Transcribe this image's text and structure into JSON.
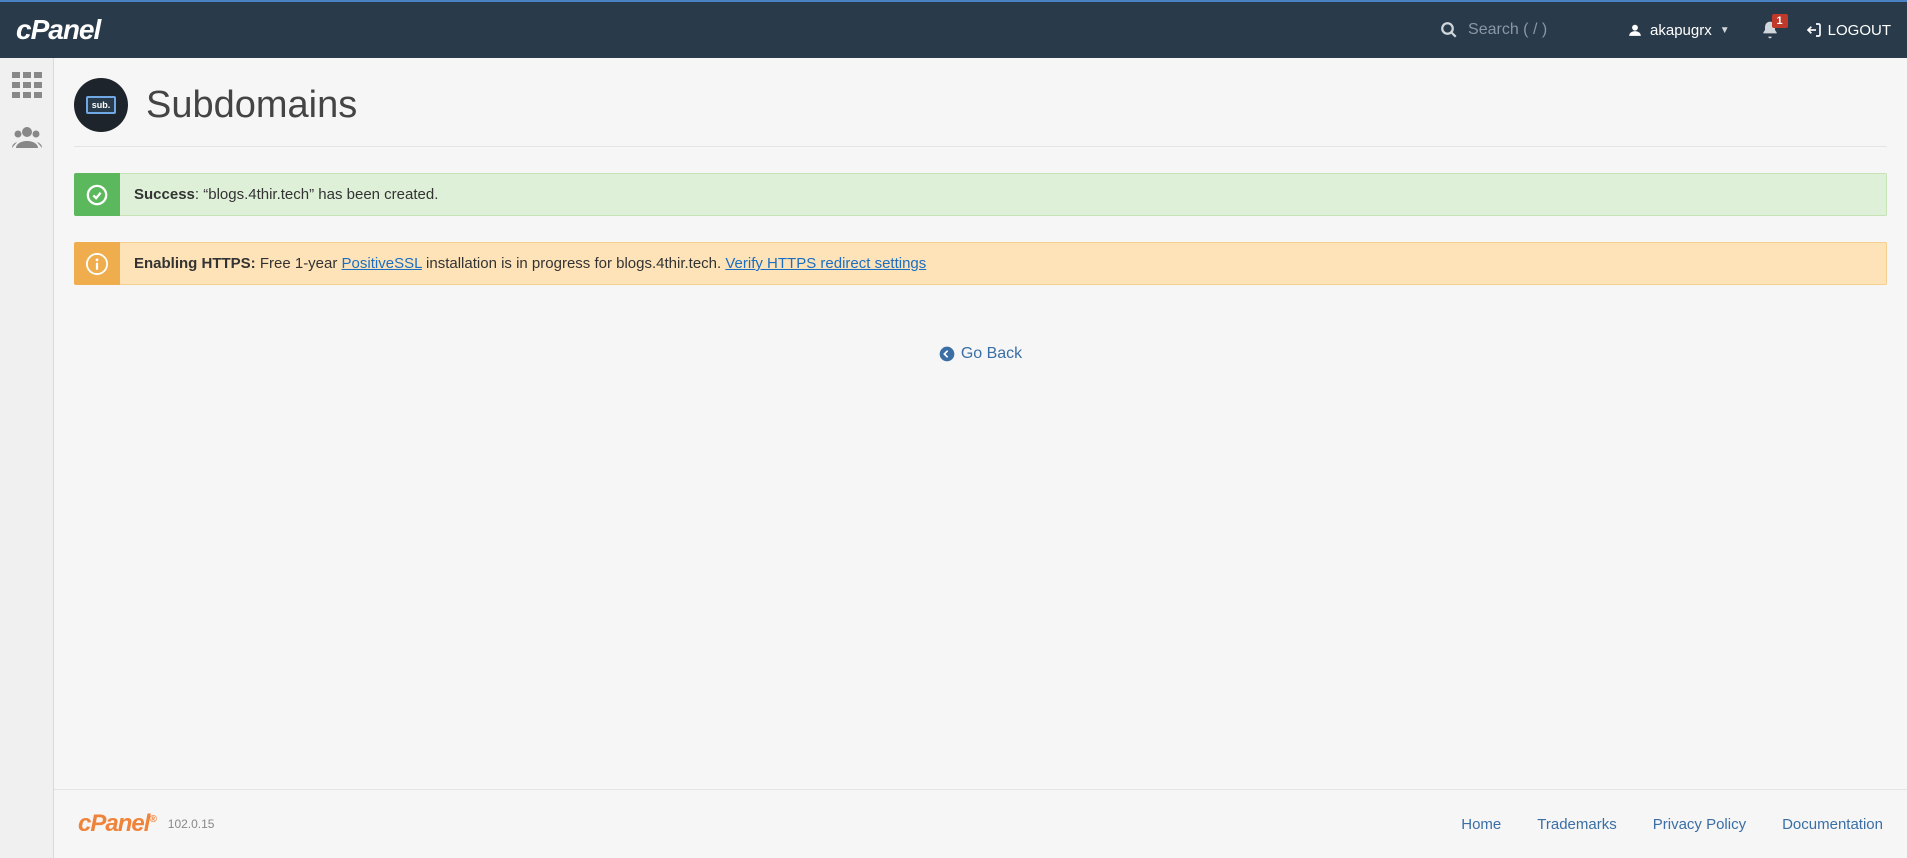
{
  "header": {
    "logo_text": "cPanel",
    "search_placeholder": "Search ( / )",
    "username": "akapugrx",
    "notification_count": "1",
    "logout_label": "LOGOUT"
  },
  "page": {
    "title": "Subdomains",
    "icon_label": "sub."
  },
  "alerts": {
    "success": {
      "label": "Success",
      "message": ": “blogs.4thir.tech” has been created."
    },
    "info": {
      "label": "Enabling HTTPS:",
      "text_before": " Free 1-year ",
      "link1": "PositiveSSL",
      "text_mid": " installation is in progress for blogs.4thir.tech. ",
      "link2": "Verify HTTPS redirect settings"
    }
  },
  "go_back_label": "Go Back",
  "footer": {
    "logo_text": "cPanel",
    "version": "102.0.15",
    "links": {
      "home": "Home",
      "trademarks": "Trademarks",
      "privacy": "Privacy Policy",
      "docs": "Documentation"
    }
  }
}
